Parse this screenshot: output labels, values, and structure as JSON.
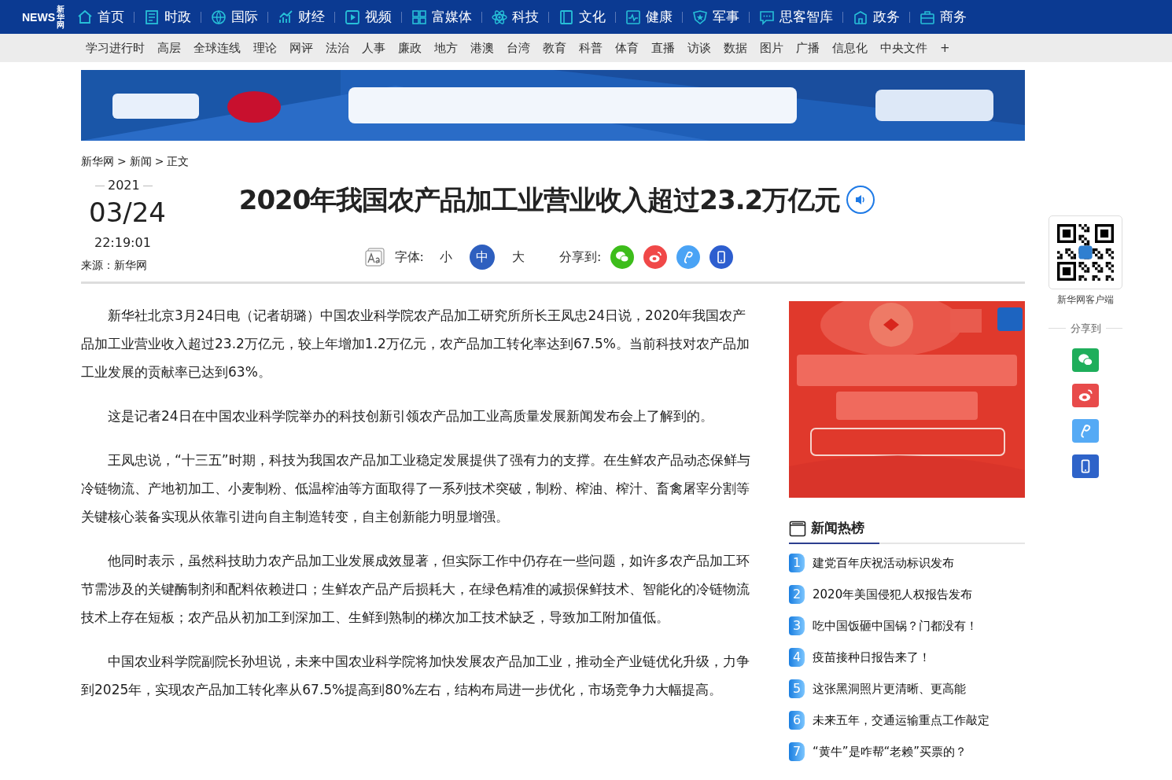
{
  "logo": {
    "name": "新华网",
    "mark": "NEWS"
  },
  "nav": [
    {
      "label": "首页"
    },
    {
      "label": "时政"
    },
    {
      "label": "国际"
    },
    {
      "label": "财经"
    },
    {
      "label": "视频"
    },
    {
      "label": "富媒体"
    },
    {
      "label": "科技"
    },
    {
      "label": "文化"
    },
    {
      "label": "健康"
    },
    {
      "label": "军事"
    },
    {
      "label": "思客智库"
    },
    {
      "label": "政务"
    },
    {
      "label": "商务"
    }
  ],
  "subnav": [
    "学习进行时",
    "高层",
    "全球连线",
    "理论",
    "网评",
    "法治",
    "人事",
    "廉政",
    "地方",
    "港澳",
    "台湾",
    "教育",
    "科普",
    "体育",
    "直播",
    "访谈",
    "数据",
    "图片",
    "广播",
    "信息化",
    "中央文件",
    "+"
  ],
  "breadcrumb": {
    "separator": ">",
    "items": [
      "新华网",
      "新闻",
      "正文"
    ]
  },
  "date": {
    "year": "2021",
    "day": "03/24",
    "time": "22:19:01",
    "source": "来源：新华网"
  },
  "title": "2020年我国农产品加工业营业收入超过23.2万亿元",
  "font_size": {
    "label": "字体:",
    "options": [
      {
        "label": "小",
        "selected": false
      },
      {
        "label": "中",
        "selected": true
      },
      {
        "label": "大",
        "selected": false
      }
    ]
  },
  "share": {
    "label": "分享到:"
  },
  "paragraphs": [
    "新华社北京3月24日电（记者胡璐）中国农业科学院农产品加工研究所所长王凤忠24日说，2020年我国农产品加工业营业收入超过23.2万亿元，较上年增加1.2万亿元，农产品加工转化率达到67.5%。当前科技对农产品加工业发展的贡献率已达到63%。",
    "这是记者24日在中国农业科学院举办的科技创新引领农产品加工业高质量发展新闻发布会上了解到的。",
    "王凤忠说，“十三五”时期，科技为我国农产品加工业稳定发展提供了强有力的支撑。在生鲜农产品动态保鲜与冷链物流、产地初加工、小麦制粉、低温榨油等方面取得了一系列技术突破，制粉、榨油、榨汁、畜禽屠宰分割等关键核心装备实现从依靠引进向自主制造转变，自主创新能力明显增强。",
    "他同时表示，虽然科技助力农产品加工业发展成效显著，但实际工作中仍存在一些问题，如许多农产品加工环节需涉及的关键酶制剂和配料依赖进口；生鲜农产品产后损耗大，在绿色精准的减损保鲜技术、智能化的冷链物流技术上存在短板；农产品从初加工到深加工、生鲜到熟制的梯次加工技术缺乏，导致加工附加值低。",
    "中国农业科学院副院长孙坦说，未来中国农业科学院将加快发展农产品加工业，推动全产业链优化升级，力争到2025年，实现农产品加工转化率从67.5%提高到80%左右，结构布局进一步优化，市场竞争力大幅提高。"
  ],
  "hot_list": {
    "title": "新闻热榜",
    "items": [
      {
        "rank": "1",
        "text": "建党百年庆祝活动标识发布"
      },
      {
        "rank": "2",
        "text": "2020年美国侵犯人权报告发布"
      },
      {
        "rank": "3",
        "text": "吃中国饭砸中国锅？门都没有！"
      },
      {
        "rank": "4",
        "text": "疫苗接种日报告来了！"
      },
      {
        "rank": "5",
        "text": "这张黑洞照片更清晰、更高能"
      },
      {
        "rank": "6",
        "text": "未来五年，交通运输重点工作敲定"
      },
      {
        "rank": "7",
        "text": "“黄牛”是咋帮“老赖”买票的？"
      }
    ]
  },
  "side": {
    "app_label": "新华网客户端",
    "share_label": "分享到"
  }
}
